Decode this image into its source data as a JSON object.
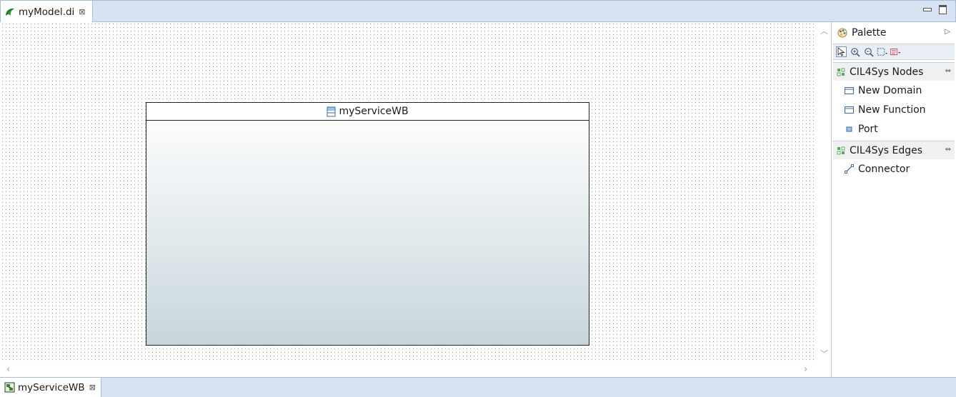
{
  "editor_tab": {
    "title": "myModel.di",
    "icon": "papyrus-model-icon",
    "close": "⊠"
  },
  "diagram": {
    "node": {
      "name": "myServiceWB",
      "icon": "class-icon"
    }
  },
  "palette": {
    "title": "Palette",
    "toolbar": [
      "select-tool-icon",
      "zoom-in-icon",
      "zoom-out-icon",
      "marquee-icon",
      "filter-icon"
    ],
    "drawers": [
      {
        "label": "CIL4Sys Nodes",
        "tools": [
          {
            "label": "New Domain",
            "icon": "rectangle-icon"
          },
          {
            "label": "New Function",
            "icon": "rectangle-icon"
          },
          {
            "label": "Port",
            "icon": "port-icon"
          }
        ]
      },
      {
        "label": "CIL4Sys Edges",
        "tools": [
          {
            "label": "Connector",
            "icon": "connector-icon"
          }
        ]
      }
    ]
  },
  "bottom_tab": {
    "title": "myServiceWB",
    "icon": "diagram-icon",
    "close": "⊠"
  },
  "colors": {
    "tab_bar": "#d7e3f2",
    "border": "#a8bcd6",
    "node_gradient_end": "#c6d6dc"
  }
}
